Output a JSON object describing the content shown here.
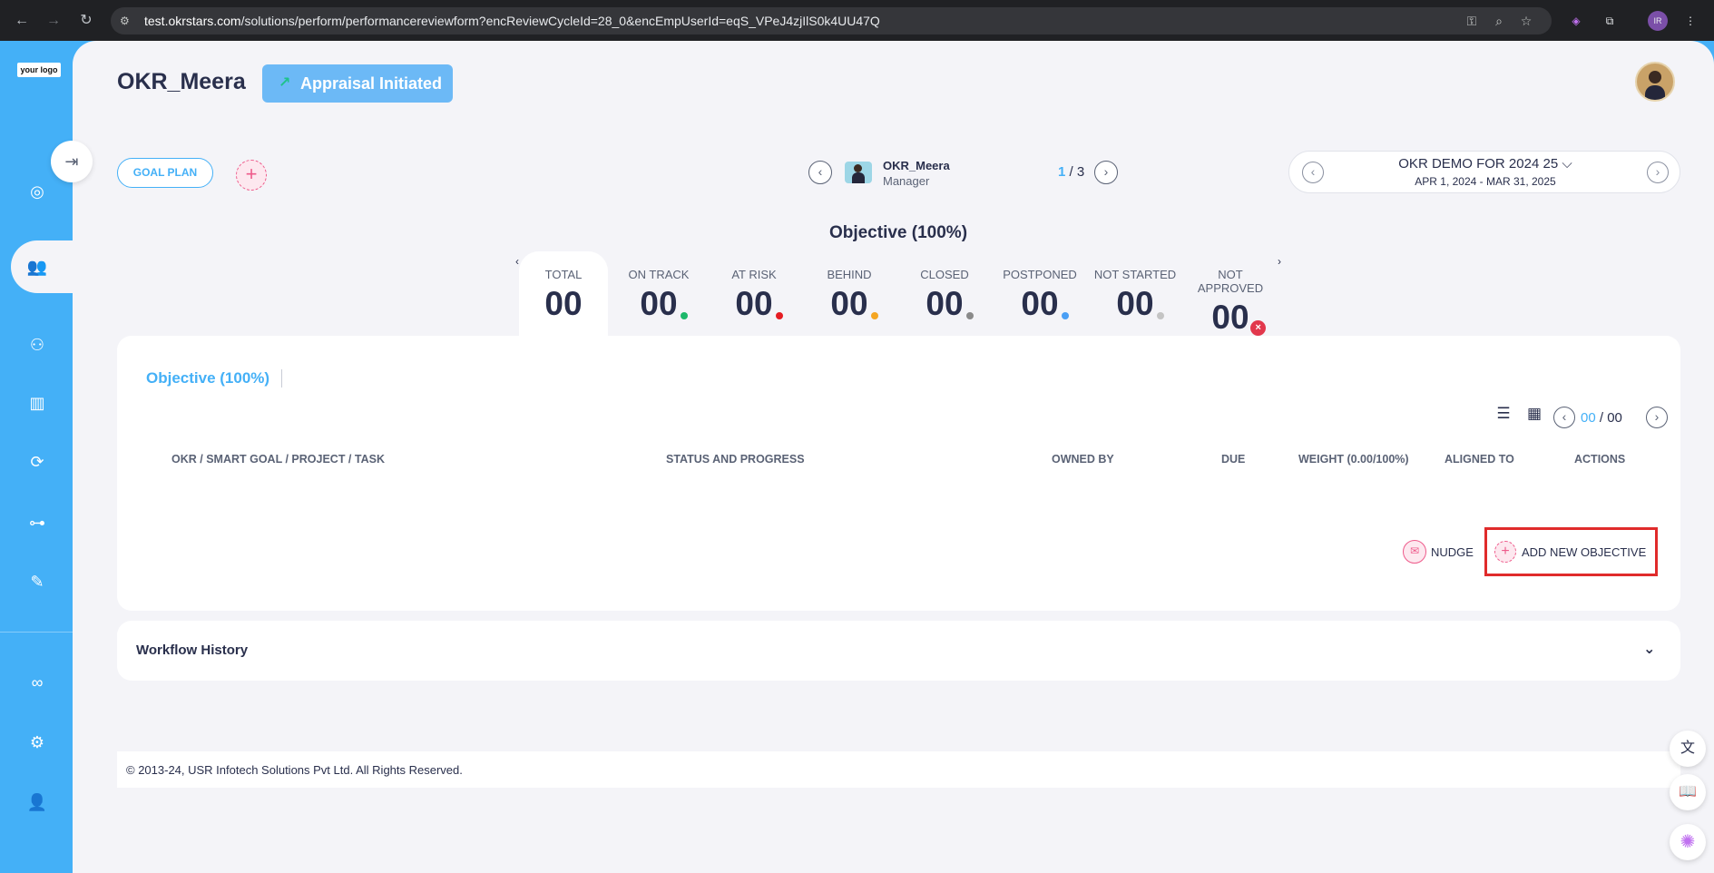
{
  "browser": {
    "url_host": "test.okrstars.com",
    "url_path": "/solutions/perform/performancereviewform?encReviewCycleId=28_0&encEmpUserId=eqS_VPeJ4zjIlS0k4UU47Q",
    "back_icon": "←",
    "forward_icon": "→",
    "reload_icon": "↻",
    "site_settings_icon": "⚙",
    "key_icon": "⚿",
    "zoom_icon": "⌕",
    "star_icon": "☆",
    "extension1_icon": "◈",
    "extensions_icon": "⧉",
    "profile_initials": "IR",
    "menu_icon": "⋮"
  },
  "sidebar": {
    "logo_text": "your logo",
    "items": [
      {
        "icon": "target-icon",
        "glyph": "◎"
      },
      {
        "icon": "team-icon",
        "glyph": "👥"
      },
      {
        "icon": "people-icon",
        "glyph": "⚇"
      },
      {
        "icon": "book-icon",
        "glyph": "▥"
      },
      {
        "icon": "feedback-360-icon",
        "glyph": "⟳"
      },
      {
        "icon": "hierarchy-icon",
        "glyph": "⊶"
      },
      {
        "icon": "report-icon",
        "glyph": "✎"
      },
      {
        "icon": "glasses-icon",
        "glyph": "∞"
      },
      {
        "icon": "settings-icon",
        "glyph": "⚙"
      },
      {
        "icon": "user-icon",
        "glyph": "👤"
      }
    ]
  },
  "header": {
    "title": "OKR_Meera",
    "status_label": "Appraisal Initiated",
    "status_icon": "↗",
    "collapse_icon": "⇥"
  },
  "toolbar": {
    "goal_plan_label": "GOAL PLAN",
    "add_icon": "+",
    "employee_name": "OKR_Meera",
    "employee_role": "Manager",
    "page_current": "1",
    "page_total": "3",
    "prev_icon": "‹",
    "next_icon": "›"
  },
  "cycle": {
    "name": "OKR DEMO FOR 2024 25",
    "dates": "APR 1, 2024 - MAR 31, 2025",
    "dropdown_icon": "⌵"
  },
  "summary": {
    "heading": "Objective (100%)",
    "stats": [
      {
        "label": "TOTAL",
        "value": "00",
        "color": ""
      },
      {
        "label": "ON TRACK",
        "value": "00",
        "color": "#1db86b"
      },
      {
        "label": "AT RISK",
        "value": "00",
        "color": "#e51c23"
      },
      {
        "label": "BEHIND",
        "value": "00",
        "color": "#f5a623"
      },
      {
        "label": "CLOSED",
        "value": "00",
        "color": "#8a8a8a"
      },
      {
        "label": "POSTPONED",
        "value": "00",
        "color": "#4a9ff5"
      },
      {
        "label": "NOT STARTED",
        "value": "00",
        "color": "#c4c4c4"
      },
      {
        "label": "NOT APPROVED",
        "value": "00",
        "color": "#e2374c"
      }
    ]
  },
  "objectives_card": {
    "tab_label": "Objective (100%)",
    "list_view_icon": "☰",
    "grid_view_icon": "▦",
    "page_current": "00",
    "page_total": "00",
    "columns": [
      "OKR / SMART GOAL / PROJECT / TASK",
      "STATUS AND PROGRESS",
      "OWNED BY",
      "DUE",
      "WEIGHT (0.00/100%)",
      "ALIGNED TO",
      "ACTIONS"
    ],
    "nudge_label": "NUDGE",
    "nudge_icon": "✉",
    "add_objective_label": "ADD NEW OBJECTIVE"
  },
  "workflow": {
    "label": "Workflow History",
    "chevron": "⌄"
  },
  "footer": {
    "text": "© 2013-24, USR Infotech Solutions Pvt Ltd. All Rights Reserved."
  },
  "floating": {
    "translate_icon": "文",
    "guide_icon": "📖",
    "ai_icon": "✺"
  }
}
